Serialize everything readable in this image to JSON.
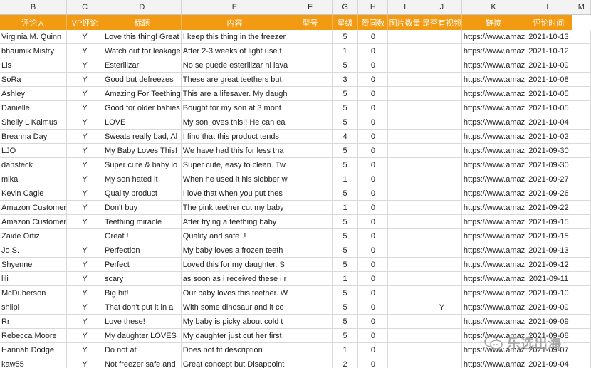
{
  "column_letters": [
    "B",
    "C",
    "D",
    "E",
    "F",
    "G",
    "H",
    "I",
    "J",
    "K",
    "L",
    "M"
  ],
  "header_labels": [
    "评论人",
    "VP评论",
    "标题",
    "内容",
    "型号",
    "星级",
    "赞同数",
    "图片数量",
    "是否有视频",
    "链接",
    "评论时间"
  ],
  "header_color": "#f29b12",
  "rows": [
    {
      "reviewer": "Virginia M. Quinn",
      "vp": "Y",
      "title": "Love this thing! Great",
      "content": "I keep this thing in the freezer",
      "stars": "5",
      "likes": "0",
      "video": "",
      "link": "https://www.amaz",
      "date": "2021-10-13"
    },
    {
      "reviewer": "bhaumik Mistry",
      "vp": "Y",
      "title": "Watch out for leakage",
      "content": "After 2-3 weeks of light use t",
      "stars": "1",
      "likes": "0",
      "video": "",
      "link": "https://www.amaz",
      "date": "2021-10-12"
    },
    {
      "reviewer": "Lis",
      "vp": "Y",
      "title": "Esterilizar",
      "content": "No se puede esterilizar ni lava",
      "stars": "5",
      "likes": "0",
      "video": "",
      "link": "https://www.amaz",
      "date": "2021-10-09"
    },
    {
      "reviewer": "SoRa",
      "vp": "Y",
      "title": "Good but defreezes",
      "content": "These are great teethers but",
      "stars": "3",
      "likes": "0",
      "video": "",
      "link": "https://www.amaz",
      "date": "2021-10-08"
    },
    {
      "reviewer": "Ashley",
      "vp": "Y",
      "title": "Amazing For Teething",
      "content": "This are a lifesaver. My daugh",
      "stars": "5",
      "likes": "0",
      "video": "",
      "link": "https://www.amaz",
      "date": "2021-10-05"
    },
    {
      "reviewer": "Danielle",
      "vp": "Y",
      "title": "Good for older babies",
      "content": "Bought for my son at 3 mont",
      "stars": "5",
      "likes": "0",
      "video": "",
      "link": "https://www.amaz",
      "date": "2021-10-05"
    },
    {
      "reviewer": "Shelly L Kalmus",
      "vp": "Y",
      "title": "LOVE",
      "content": "My son loves this!! He can ea",
      "stars": "5",
      "likes": "0",
      "video": "",
      "link": "https://www.amaz",
      "date": "2021-10-04"
    },
    {
      "reviewer": "Breanna Day",
      "vp": "Y",
      "title": "Sweats really bad, Al",
      "content": "I find that this product tends",
      "stars": "4",
      "likes": "0",
      "video": "",
      "link": "https://www.amaz",
      "date": "2021-10-02"
    },
    {
      "reviewer": "LJO",
      "vp": "Y",
      "title": "My Baby Loves This!",
      "content": "We have had this for less tha",
      "stars": "5",
      "likes": "0",
      "video": "",
      "link": "https://www.amaz",
      "date": "2021-09-30"
    },
    {
      "reviewer": "dansteck",
      "vp": "Y",
      "title": "Super cute & baby lo",
      "content": "Super cute, easy to clean. Tw",
      "stars": "5",
      "likes": "0",
      "video": "",
      "link": "https://www.amaz",
      "date": "2021-09-30"
    },
    {
      "reviewer": "mika",
      "vp": "Y",
      "title": "My son hated it",
      "content": "When he used it his slobber w",
      "stars": "1",
      "likes": "0",
      "video": "",
      "link": "https://www.amaz",
      "date": "2021-09-27"
    },
    {
      "reviewer": "Kevin Cagle",
      "vp": "Y",
      "title": "Quality product",
      "content": "I love that when you put thes",
      "stars": "5",
      "likes": "0",
      "video": "",
      "link": "https://www.amaz",
      "date": "2021-09-26"
    },
    {
      "reviewer": "Amazon Customer",
      "vp": "Y",
      "title": "Don't buy",
      "content": "The pink teether cut my baby",
      "stars": "1",
      "likes": "0",
      "video": "",
      "link": "https://www.amaz",
      "date": "2021-09-22"
    },
    {
      "reviewer": "Amazon Customer",
      "vp": "Y",
      "title": "Teething miracle",
      "content": "After trying a teething baby",
      "stars": "5",
      "likes": "0",
      "video": "",
      "link": "https://www.amaz",
      "date": "2021-09-15"
    },
    {
      "reviewer": "Zaide Ortiz",
      "vp": "",
      "title": "Great !",
      "content": "Quality and safe .!",
      "stars": "5",
      "likes": "0",
      "video": "",
      "link": "https://www.amaz",
      "date": "2021-09-15"
    },
    {
      "reviewer": "Jo S.",
      "vp": "Y",
      "title": "Perfection",
      "content": "My baby loves a frozen teeth",
      "stars": "5",
      "likes": "0",
      "video": "",
      "link": "https://www.amaz",
      "date": "2021-09-13"
    },
    {
      "reviewer": "Shyenne",
      "vp": "Y",
      "title": "Perfect",
      "content": "Loved this for my daughter. S",
      "stars": "5",
      "likes": "0",
      "video": "",
      "link": "https://www.amaz",
      "date": "2021-09-12"
    },
    {
      "reviewer": "lili",
      "vp": "Y",
      "title": "scary",
      "content": "as soon as i received these i r",
      "stars": "1",
      "likes": "0",
      "video": "",
      "link": "https://www.amaz",
      "date": "2021-09-11"
    },
    {
      "reviewer": "McDuberson",
      "vp": "Y",
      "title": "Big hit!",
      "content": "Our baby loves this teether. W",
      "stars": "5",
      "likes": "0",
      "video": "",
      "link": "https://www.amaz",
      "date": "2021-09-10"
    },
    {
      "reviewer": "shilpi",
      "vp": "Y",
      "title": "That don't put it in a",
      "content": "With some dinosaur and it co",
      "stars": "5",
      "likes": "0",
      "video": "Y",
      "link": "https://www.amaz",
      "date": "2021-09-09"
    },
    {
      "reviewer": "Rr",
      "vp": "Y",
      "title": "Love these!",
      "content": "My baby is picky about cold t",
      "stars": "5",
      "likes": "0",
      "video": "",
      "link": "https://www.amaz",
      "date": "2021-09-09"
    },
    {
      "reviewer": "Rebecca Moore",
      "vp": "Y",
      "title": "My daughter LOVES",
      "content": "My daughter just cut her first",
      "stars": "5",
      "likes": "0",
      "video": "",
      "link": "https://www.amaz",
      "date": "2021-09-08"
    },
    {
      "reviewer": "Hannah Dodge",
      "vp": "Y",
      "title": "Do not at",
      "content": "Does not fit description",
      "stars": "1",
      "likes": "0",
      "video": "",
      "link": "https://www.amaz",
      "date": "2021-09-07"
    },
    {
      "reviewer": "kaw55",
      "vp": "Y",
      "title": "Not freezer safe and",
      "content": "Great concept but Disappoint",
      "stars": "2",
      "likes": "0",
      "video": "",
      "link": "https://www.amaz",
      "date": "2021-09-04"
    }
  ],
  "watermark": {
    "text": "乐选出海",
    "icon": "chat-bubbles-icon"
  }
}
